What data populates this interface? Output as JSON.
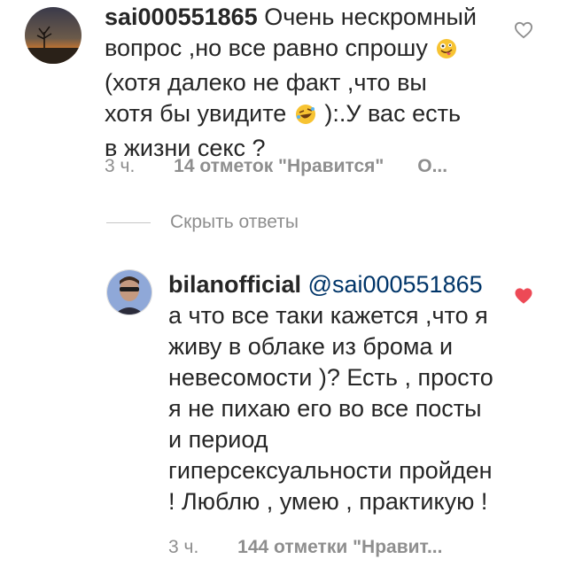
{
  "comment1": {
    "username": "sai000551865",
    "text_part1": "Очень нескромный вопрос ,но все равно спрошу",
    "text_part2": "(хотя далеко не факт ,что вы хотя бы увидите",
    "text_part3": "):.У вас есть в жизни секс ?",
    "emoji1": "zany-face-emoji",
    "emoji2": "rofl-emoji",
    "time": "3 ч.",
    "likes": "14 отметок \"Нравится\"",
    "reply": "О...",
    "liked": false
  },
  "hide_replies": {
    "label": "Скрыть ответы"
  },
  "comment2": {
    "username": "bilanofficial",
    "mention": "@sai000551865",
    "text": "а что все таки кажется ,что я живу в облаке из брома и невесомости )? Есть , просто я не пихаю его во все посты и период гиперсексуальности пройден ! Люблю , умею , практикую !",
    "time": "3 ч.",
    "likes": "144 отметки \"Нравит...",
    "liked": true
  },
  "colors": {
    "text": "#262626",
    "secondary": "#8e8e8e",
    "mention": "#003569",
    "heart_liked": "#ed4956",
    "heart_outline": "#8e8e8e"
  }
}
